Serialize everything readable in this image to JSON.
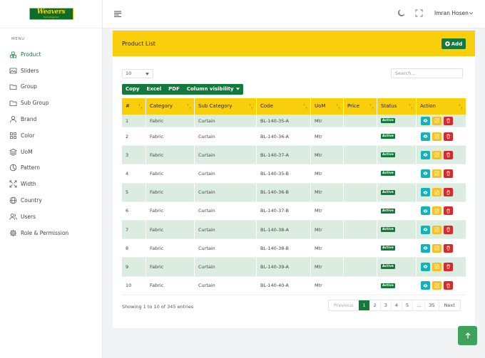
{
  "brand": {
    "logo_text": "Weavers",
    "logo_sub": "Furnishing Ltd"
  },
  "sidebar": {
    "menu_label": "MENU",
    "items": [
      {
        "label": "Product",
        "icon": "product-icon"
      },
      {
        "label": "Sliders",
        "icon": "image-icon"
      },
      {
        "label": "Group",
        "icon": "folder-icon"
      },
      {
        "label": "Sub Group",
        "icon": "folder-icon"
      },
      {
        "label": "Brand",
        "icon": "user-tag-icon"
      },
      {
        "label": "Color",
        "icon": "grid-icon"
      },
      {
        "label": "UoM",
        "icon": "layers-icon"
      },
      {
        "label": "Pattern",
        "icon": "pattern-icon"
      },
      {
        "label": "Width",
        "icon": "expand-arrows-icon"
      },
      {
        "label": "Country",
        "icon": "globe-icon"
      },
      {
        "label": "Users",
        "icon": "users-icon"
      },
      {
        "label": "Role & Permission",
        "icon": "gear-icon"
      }
    ]
  },
  "header": {
    "user_name": "Imran Hosen"
  },
  "card": {
    "title": "Product List",
    "add_label": "Add"
  },
  "controls": {
    "page_length": "10",
    "search_placeholder": "Search...",
    "export_buttons": [
      "Copy",
      "Excel",
      "PDF",
      "Column visibility"
    ]
  },
  "table": {
    "columns": [
      "#",
      "Category",
      "Sub Category",
      "Code",
      "UoM",
      "Price",
      "Status",
      "Action"
    ],
    "rows": [
      {
        "no": "1",
        "category": "Fabric",
        "sub_category": "Curtain",
        "code": "BL-140-35-A",
        "uom": "Mtr",
        "price": "",
        "status": "Active"
      },
      {
        "no": "2",
        "category": "Fabric",
        "sub_category": "Curtain",
        "code": "BL-140-36-A",
        "uom": "Mtr",
        "price": "",
        "status": "Active"
      },
      {
        "no": "3",
        "category": "Fabric",
        "sub_category": "Curtain",
        "code": "BL-140-37-A",
        "uom": "Mtr",
        "price": "",
        "status": "Active"
      },
      {
        "no": "4",
        "category": "Fabric",
        "sub_category": "Curtain",
        "code": "BL-140-35-B",
        "uom": "Mtr",
        "price": "",
        "status": "Active"
      },
      {
        "no": "5",
        "category": "Fabric",
        "sub_category": "Curtain",
        "code": "BL-140-36-B",
        "uom": "Mtr",
        "price": "",
        "status": "Active"
      },
      {
        "no": "6",
        "category": "Fabric",
        "sub_category": "Curtain",
        "code": "BL-140-37-B",
        "uom": "Mtr",
        "price": "",
        "status": "Active"
      },
      {
        "no": "7",
        "category": "Fabric",
        "sub_category": "Curtain",
        "code": "BL-140-38-A",
        "uom": "Mtr",
        "price": "",
        "status": "Active"
      },
      {
        "no": "8",
        "category": "Fabric",
        "sub_category": "Curtain",
        "code": "BL-140-38-B",
        "uom": "Mtr",
        "price": "",
        "status": "Active"
      },
      {
        "no": "9",
        "category": "Fabric",
        "sub_category": "Curtain",
        "code": "BL-140-39-A",
        "uom": "Mtr",
        "price": "",
        "status": "Active"
      },
      {
        "no": "10",
        "category": "Fabric",
        "sub_category": "Curtain",
        "code": "BL-140-40-A",
        "uom": "Mtr",
        "price": "",
        "status": "Active"
      }
    ]
  },
  "pagination": {
    "info": "Showing 1 to 10 of 345 entries",
    "pages": [
      "Previous",
      "1",
      "2",
      "3",
      "4",
      "5",
      "...",
      "35",
      "Next"
    ],
    "active": "1"
  },
  "colors": {
    "brand_green": "#127a3a",
    "accent_yellow": "#f8cf0a",
    "row_stripe": "#dbece1"
  }
}
